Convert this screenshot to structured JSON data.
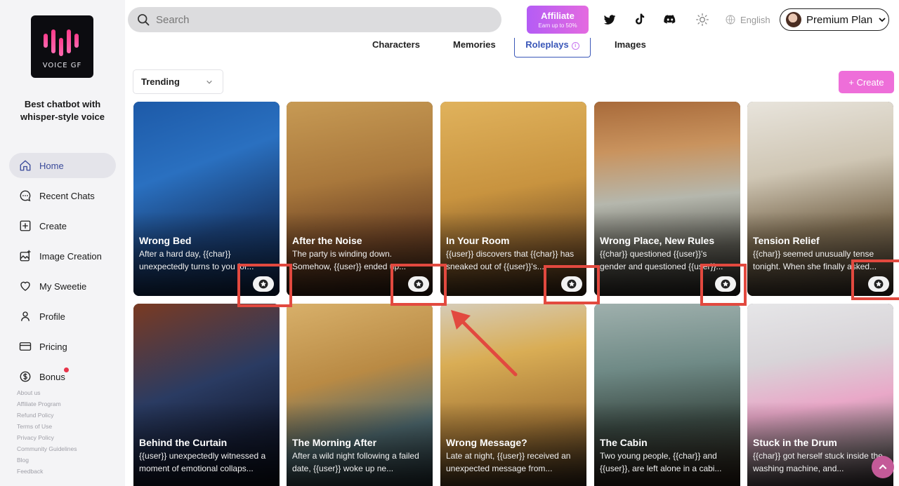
{
  "brand": {
    "logo_text": "VOICE GF",
    "tagline": "Best chatbot with whisper-style voice"
  },
  "sidebar": {
    "items": [
      {
        "label": "Home",
        "icon": "home-icon",
        "active": true
      },
      {
        "label": "Recent Chats",
        "icon": "chat-icon"
      },
      {
        "label": "Create",
        "icon": "plus-square-icon"
      },
      {
        "label": "Image Creation",
        "icon": "image-plus-icon"
      },
      {
        "label": "My Sweetie",
        "icon": "heart-icon"
      },
      {
        "label": "Profile",
        "icon": "user-icon"
      },
      {
        "label": "Pricing",
        "icon": "card-icon"
      },
      {
        "label": "Bonus",
        "icon": "dollar-icon"
      }
    ],
    "footer_links": [
      "About us",
      "Affiliate Program",
      "Refund Policy",
      "Terms of Use",
      "Privacy Policy",
      "Community Guidelines",
      "Blog",
      "Feedback"
    ]
  },
  "header": {
    "search_placeholder": "Search",
    "affiliate_label": "Affiliate",
    "affiliate_sub": "Earn up to 50%",
    "language": "English",
    "plan_label": "Premium Plan"
  },
  "tabs": [
    {
      "label": "Characters"
    },
    {
      "label": "Memories"
    },
    {
      "label": "Roleplays",
      "active": true
    },
    {
      "label": "Images"
    }
  ],
  "filter": {
    "selected": "Trending"
  },
  "create_label": "+ Create",
  "cards": [
    {
      "title": "Wrong Bed",
      "desc": "After a hard day, {{char}} unexpectedly turns to you for..."
    },
    {
      "title": "After the Noise",
      "desc": "The party is winding down. Somehow, {{user}} ended up..."
    },
    {
      "title": "In Your Room",
      "desc": "{{user}} discovers that {{char}} has sneaked out of {{user}}'s..."
    },
    {
      "title": "Wrong Place, New Rules",
      "desc": "{{char}} questioned {{user}}'s gender and questioned {{user}}..."
    },
    {
      "title": "Tension Relief",
      "desc": "{{char}} seemed unusually tense tonight. When she finally asked..."
    },
    {
      "title": "Behind the Curtain",
      "desc": "{{user}} unexpectedly witnessed a moment of emotional collaps..."
    },
    {
      "title": "The Morning After",
      "desc": "After a wild night following a failed date, {{user}} woke up ne..."
    },
    {
      "title": "Wrong Message?",
      "desc": "Late at night, {{user}} received an unexpected message from..."
    },
    {
      "title": "The Cabin",
      "desc": "Two young people, {{char}} and {{user}}, are left alone in a cabi..."
    },
    {
      "title": "Stuck in the Drum",
      "desc": "{{char}} got herself stuck inside the washing machine, and..."
    }
  ],
  "colors": {
    "accent": "#3a57b8",
    "pink": "#ee6ed9",
    "highlight": "#e2493f"
  }
}
